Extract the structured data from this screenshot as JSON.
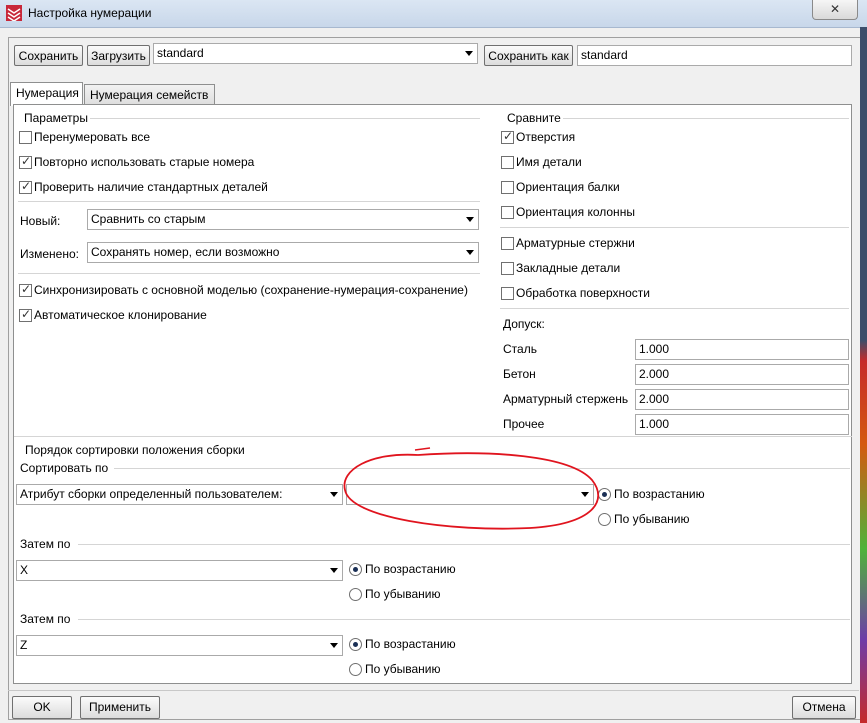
{
  "window": {
    "title": "Настройка нумерации",
    "close_label": "✕"
  },
  "toolbar": {
    "save_label": "Сохранить",
    "load_label": "Загрузить",
    "preset_value": "standard",
    "save_as_label": "Сохранить как",
    "save_as_value": "standard"
  },
  "tabs": [
    {
      "label": "Нумерация",
      "active": true
    },
    {
      "label": "Нумерация семейств",
      "active": false
    }
  ],
  "params": {
    "title": "Параметры",
    "renumber_all": {
      "label": "Перенумеровать все",
      "checked": false
    },
    "reuse_old": {
      "label": "Повторно использовать старые номера",
      "checked": true
    },
    "check_standard": {
      "label": "Проверить наличие стандартных деталей",
      "checked": true
    },
    "new_label": "Новый:",
    "new_value": "Сравнить со старым",
    "changed_label": "Изменено:",
    "changed_value": "Сохранять номер, если возможно",
    "sync": {
      "label": "Синхронизировать с основной моделью (сохранение-нумерация-сохранение)",
      "checked": true
    },
    "auto_clone": {
      "label": "Автоматическое клонирование",
      "checked": true
    }
  },
  "compare": {
    "title": "Сравните",
    "holes": {
      "label": "Отверстия",
      "checked": true
    },
    "part_name": {
      "label": "Имя детали",
      "checked": false
    },
    "beam_orientation": {
      "label": "Ориентация балки",
      "checked": false
    },
    "column_orientation": {
      "label": "Ориентация колонны",
      "checked": false
    },
    "rebars": {
      "label": "Арматурные стержни",
      "checked": false
    },
    "embeds": {
      "label": "Закладные детали",
      "checked": false
    },
    "surface": {
      "label": "Обработка поверхности",
      "checked": false
    },
    "tolerance_label": "Допуск:",
    "steel_label": "Сталь",
    "steel_value": "1.000",
    "concrete_label": "Бетон",
    "concrete_value": "2.000",
    "rebar_label": "Арматурный стержень",
    "rebar_value": "2.000",
    "other_label": "Прочее",
    "other_value": "1.000"
  },
  "sort": {
    "title": "Порядок сортировки положения сборки",
    "sort_by_label": "Сортировать по",
    "sort_by_value": "Атрибут сборки определенный пользователем:",
    "sort_by_attr_value": "",
    "then_by_label_1": "Затем по",
    "then_by_value_1": "X",
    "then_by_label_2": "Затем по",
    "then_by_value_2": "Z",
    "asc": "По возрастанию",
    "desc": "По убыванию"
  },
  "footer": {
    "ok_label": "OK",
    "apply_label": "Применить",
    "cancel_label": "Отмена"
  },
  "colors": {
    "annotation": "#e0141e"
  }
}
